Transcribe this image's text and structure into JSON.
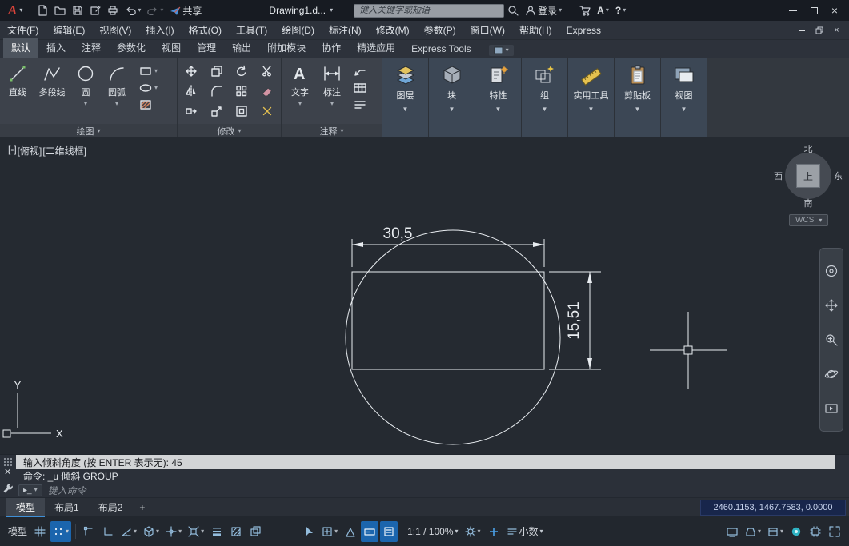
{
  "titlebar": {
    "logo_letter": "A",
    "share_label": "共享",
    "doc_title": "Drawing1.d...",
    "search_placeholder": "键入关键字或短语",
    "login_label": "登录",
    "access_label": "A",
    "help_label": "?"
  },
  "menubar": {
    "items": [
      "文件(F)",
      "编辑(E)",
      "视图(V)",
      "插入(I)",
      "格式(O)",
      "工具(T)",
      "绘图(D)",
      "标注(N)",
      "修改(M)",
      "参数(P)",
      "窗口(W)",
      "帮助(H)",
      "Express"
    ]
  },
  "ribbon": {
    "tabs": [
      "默认",
      "插入",
      "注释",
      "参数化",
      "视图",
      "管理",
      "输出",
      "附加模块",
      "协作",
      "精选应用",
      "Express Tools"
    ],
    "draw_panel": {
      "label": "绘图",
      "line": "直线",
      "polyline": "多段线",
      "circle": "圆",
      "arc": "圆弧"
    },
    "modify_panel": {
      "label": "修改"
    },
    "annotate_panel": {
      "label": "注释",
      "text": "文字",
      "dimension": "标注"
    },
    "big_panels": [
      "图层",
      "块",
      "特性",
      "组",
      "实用工具",
      "剪贴板",
      "视图"
    ]
  },
  "canvas": {
    "viewport_controls": [
      "[-]",
      "[俯视]",
      "[二维线框]"
    ],
    "viewcube": {
      "north": "北",
      "south": "南",
      "east": "东",
      "west": "西",
      "top": "上"
    },
    "wcs_label": "WCS",
    "dim_horizontal": "30,5",
    "dim_vertical": "15,51",
    "ucs_x": "X",
    "ucs_y": "Y"
  },
  "command": {
    "prompt": "输入倾斜角度 (按 ENTER 表示无): 45",
    "history": "命令: _u 倾斜 GROUP",
    "input_placeholder": "键入命令"
  },
  "layout": {
    "tabs": [
      "模型",
      "布局1",
      "布局2"
    ],
    "add_label": "+",
    "coordinates": "2460.1153, 1467.7583, 0.0000"
  },
  "statusbar": {
    "model_label": "模型",
    "scale_label": "1:1 / 100%",
    "units_label": "小数"
  }
}
